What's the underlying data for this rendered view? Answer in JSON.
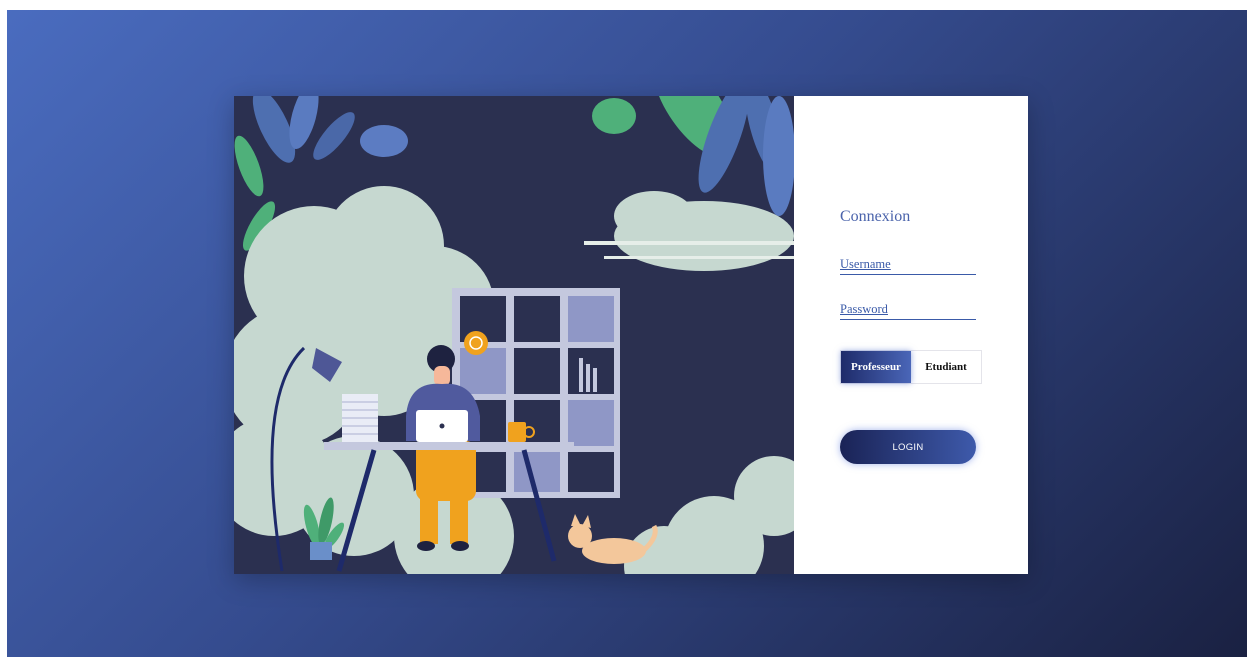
{
  "login_form": {
    "title": "Connexion",
    "username_placeholder": "Username",
    "password_placeholder": "Password",
    "roles": [
      {
        "label": "Professeur",
        "selected": true
      },
      {
        "label": "Etudiant",
        "selected": false
      }
    ],
    "submit_label": "LOGIN"
  },
  "colors": {
    "background_start": "#4a6cbf",
    "background_end": "#1a2142",
    "accent": "#3a5aa8",
    "illustration_bg": "#2b3050"
  },
  "icons": [
    "laptop-icon",
    "lamp-icon",
    "coffee-mug-icon",
    "cat-icon",
    "plant-icon",
    "chat-bubble-icon"
  ]
}
